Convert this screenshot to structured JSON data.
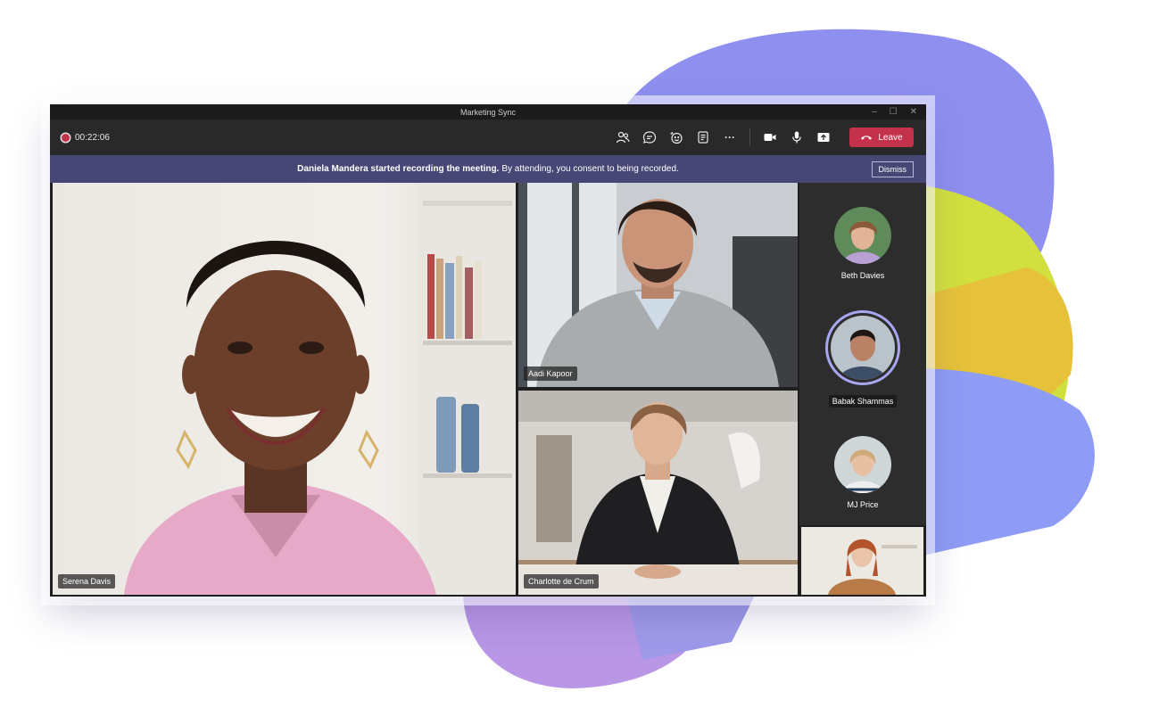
{
  "window": {
    "title": "Marketing Sync",
    "controls": [
      "–",
      "☐",
      "✕"
    ]
  },
  "toolbar": {
    "timer": "00:22:06",
    "buttons": [
      "people-icon",
      "chat-icon",
      "reactions-icon",
      "notes-icon",
      "more-icon",
      "camera-icon",
      "mic-icon",
      "share-icon"
    ],
    "more_label": "···",
    "leave_label": "Leave"
  },
  "banner": {
    "bold_text": "Daniela Mandera started recording the meeting.",
    "text": "By attending, you consent to being recorded.",
    "dismiss_label": "Dismiss"
  },
  "participants": {
    "main": "Serena Davis",
    "top_right": "Aadi Kapoor",
    "bottom_right": "Charlotte de Crum",
    "rail": [
      "Beth Davies",
      "Babak Shammas",
      "MJ Price"
    ]
  },
  "colors": {
    "accent": "#464775",
    "leave": "#c4314b",
    "speaking_ring": "#a6a7f0"
  }
}
